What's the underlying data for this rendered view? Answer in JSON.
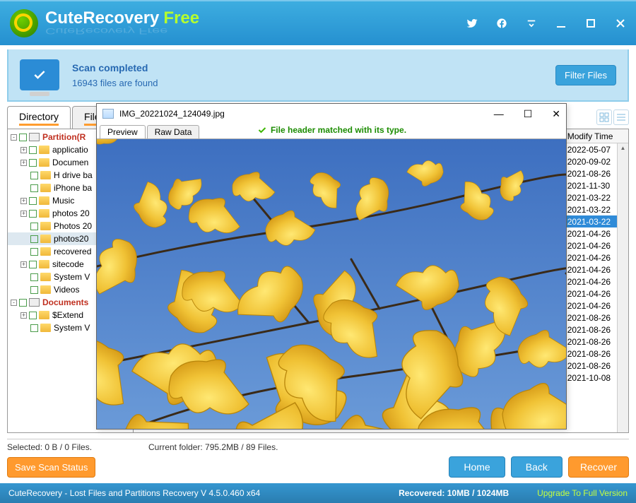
{
  "app": {
    "name_main": "CuteRecovery",
    "name_sub": "Free",
    "reflect": "CuteRecovery Free"
  },
  "status": {
    "title": "Scan completed",
    "count": "16943 files are found",
    "filter_btn": "Filter Files"
  },
  "tabs": {
    "dir": "Directory",
    "file": "File t"
  },
  "tree": {
    "partition": "Partition(R",
    "items": [
      "applicatio",
      "Documen",
      "H drive ba",
      "iPhone ba",
      "Music",
      "photos 20",
      "Photos 20",
      "photos20",
      "recovered",
      "sitecode",
      "System V",
      "Videos"
    ],
    "documents": "Documents",
    "doc_items": [
      "$Extend",
      "System V"
    ]
  },
  "list": {
    "header_modify": "Modify Time",
    "modify_dates": [
      "2022-05-07",
      "2020-09-02",
      "2021-08-26",
      "2021-11-30",
      "2021-03-22",
      "2021-03-22",
      "2021-03-22",
      "2021-04-26",
      "2021-04-26",
      "2021-04-26",
      "2021-04-26",
      "2021-04-26",
      "2021-04-26",
      "2021-04-26",
      "2021-08-26",
      "2021-08-26",
      "2021-08-26",
      "2021-08-26",
      "2021-08-26",
      "2021-10-08"
    ],
    "selected_index": 6
  },
  "preview": {
    "title": "IMG_20221024_124049.jpg",
    "tab_preview": "Preview",
    "tab_raw": "Raw Data",
    "status": "File header matched with its type."
  },
  "info": {
    "selected": "Selected: 0 B / 0 Files.",
    "current": "Current folder: 795.2MB / 89 Files."
  },
  "actions": {
    "save": "Save Scan Status",
    "home": "Home",
    "back": "Back",
    "recover": "Recover"
  },
  "footer": {
    "left": "CuteRecovery - Lost Files and Partitions Recovery  V 4.5.0.460 x64",
    "recovered": "Recovered: 10MB / 1024MB",
    "upgrade": "Upgrade To Full Version"
  }
}
